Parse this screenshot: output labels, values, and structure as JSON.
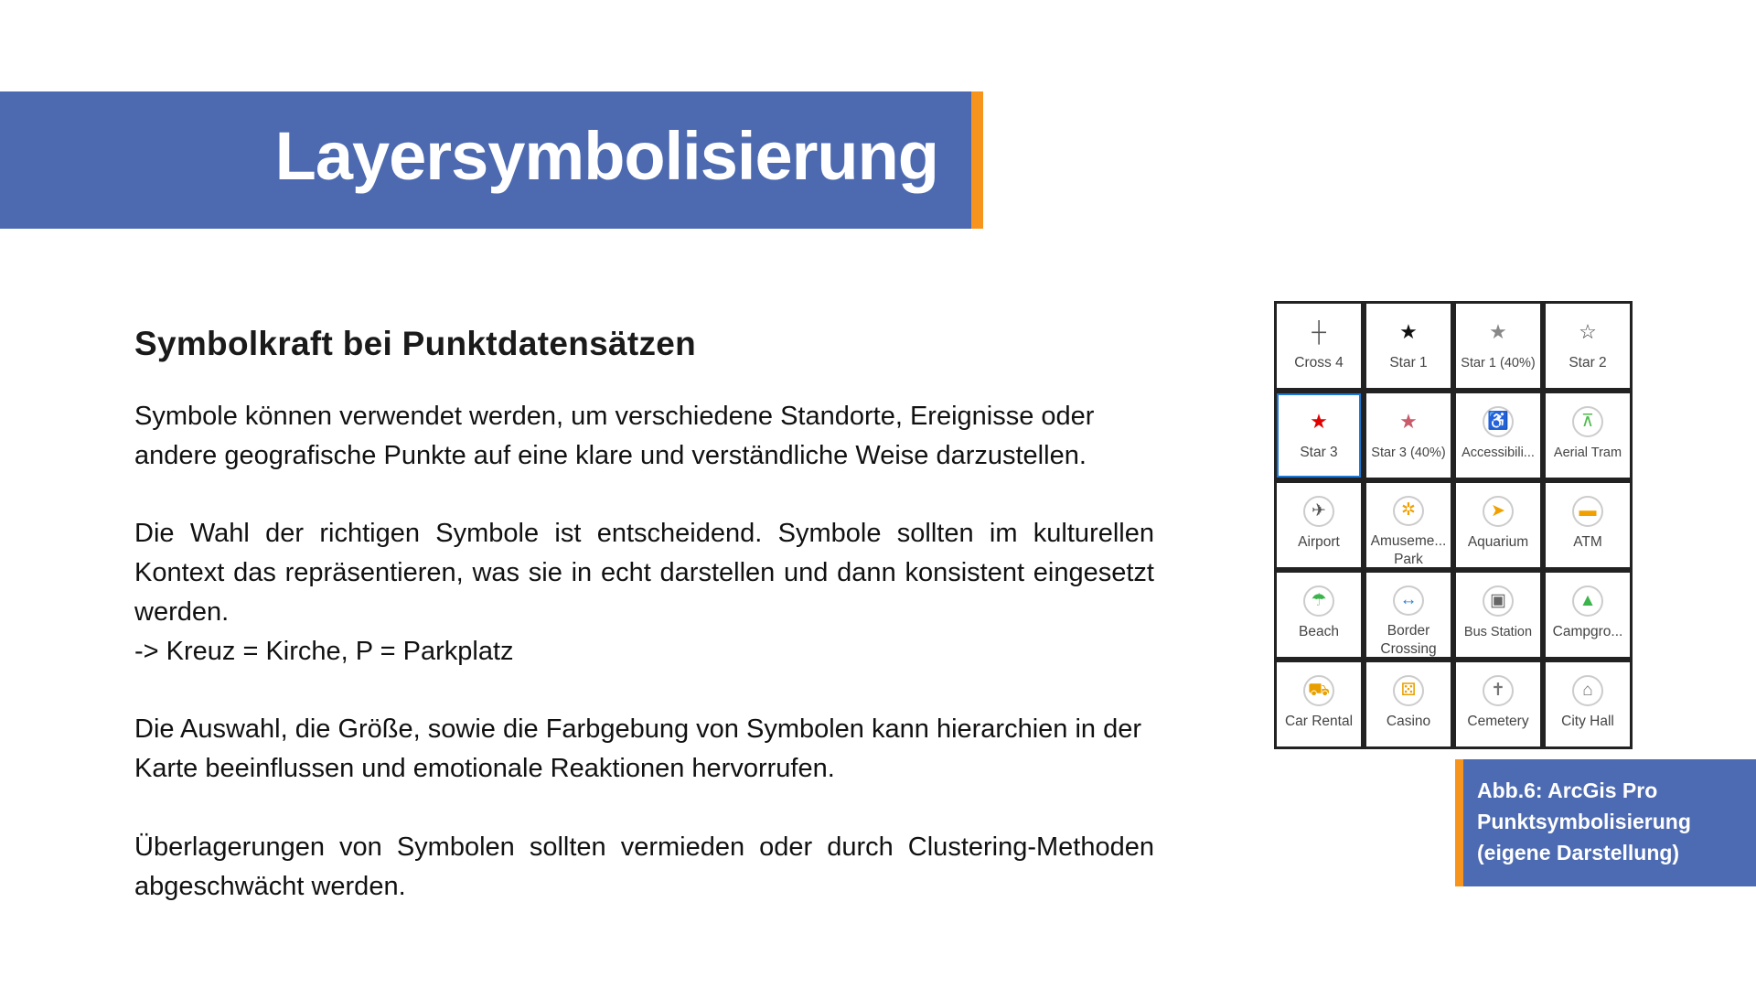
{
  "header": {
    "title": "Layersymbolisierung",
    "accent_color": "#4d6ab0",
    "stripe_color": "#f7941d"
  },
  "main": {
    "heading": "Symbolkraft bei Punktdatensätzen",
    "paragraphs": [
      "Symbole können verwendet werden, um verschiedene Standorte, Ereignisse oder andere geografische Punkte auf eine klare und verständliche Weise darzustellen.",
      "Die Wahl der richtigen Symbole ist entscheidend. Symbole sollten im kulturellen Kontext das repräsentieren, was sie in echt darstellen und dann konsistent eingesetzt werden.",
      "-> Kreuz = Kirche, P = Parkplatz",
      "Die Auswahl, die Größe, sowie die Farbgebung von Symbolen kann hierarchien in der Karte beeinflussen und emotionale Reaktionen hervorrufen.",
      "Überlagerungen von Symbolen sollten vermieden oder durch Clustering-Methoden abgeschwächt werden."
    ]
  },
  "symbol_gallery": {
    "items": [
      {
        "label": "Cross 4",
        "icon": "cross-icon"
      },
      {
        "label": "Star 1",
        "icon": "star-icon"
      },
      {
        "label": "Star 1 (40%)",
        "icon": "star-gray-icon"
      },
      {
        "label": "Star 2",
        "icon": "star-outline-icon"
      },
      {
        "label": "Star 3",
        "icon": "star-red-icon",
        "selected": true
      },
      {
        "label": "Star 3 (40%)",
        "icon": "star-red-light-icon"
      },
      {
        "label": "Accessibili...",
        "icon": "wheelchair-icon"
      },
      {
        "label": "Aerial Tram",
        "icon": "aerial-tram-icon"
      },
      {
        "label": "Airport",
        "icon": "airplane-icon"
      },
      {
        "label": "Amuseme... Park",
        "icon": "amusement-park-icon"
      },
      {
        "label": "Aquarium",
        "icon": "fish-icon"
      },
      {
        "label": "ATM",
        "icon": "card-icon"
      },
      {
        "label": "Beach",
        "icon": "umbrella-icon"
      },
      {
        "label": "Border Crossing",
        "icon": "border-arrows-icon"
      },
      {
        "label": "Bus Station",
        "icon": "bus-icon"
      },
      {
        "label": "Campgro...",
        "icon": "tent-icon"
      },
      {
        "label": "Car Rental",
        "icon": "car-icon"
      },
      {
        "label": "Casino",
        "icon": "dice-icon"
      },
      {
        "label": "Cemetery",
        "icon": "cemetery-icon"
      },
      {
        "label": "City Hall",
        "icon": "city-hall-icon"
      }
    ]
  },
  "caption": {
    "lines": [
      "Abb.6: ArcGis Pro",
      "Punktsymbolisierung",
      "(eigene Darstellung)"
    ]
  }
}
